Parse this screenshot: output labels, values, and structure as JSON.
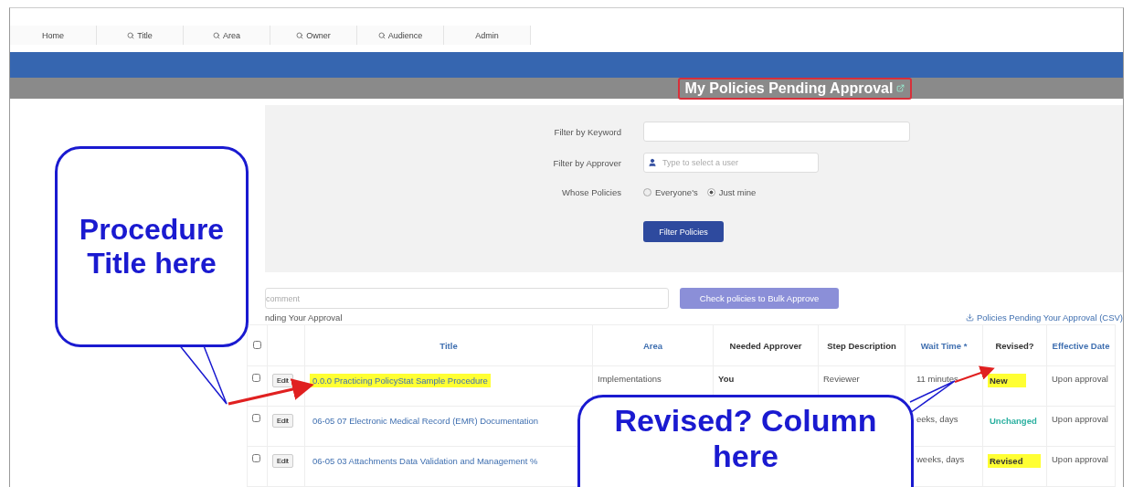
{
  "nav": {
    "tabs": [
      {
        "label": "Home",
        "search": false
      },
      {
        "label": "Title",
        "search": true
      },
      {
        "label": "Area",
        "search": true
      },
      {
        "label": "Owner",
        "search": true
      },
      {
        "label": "Audience",
        "search": true
      },
      {
        "label": "Admin",
        "search": false
      }
    ]
  },
  "header": {
    "title": "My Policies Pending Approval"
  },
  "filters": {
    "keyword": {
      "label": "Filter by Keyword"
    },
    "approver": {
      "label": "Filter by Approver",
      "placeholder": "Type to select a user"
    },
    "whose": {
      "label": "Whose Policies",
      "options": [
        {
          "label": "Everyone's",
          "selected": false
        },
        {
          "label": "Just mine",
          "selected": true
        }
      ]
    },
    "button": "Filter Policies"
  },
  "bulk": {
    "comment_placeholder": "comment",
    "button": "Check policies to Bulk Approve",
    "caption": "nding Your Approval",
    "csv_link": "Policies Pending Your Approval (CSV)"
  },
  "table": {
    "select_all_checked": false,
    "columns": [
      {
        "label": "Title",
        "sortable": true
      },
      {
        "label": "Area",
        "sortable": true
      },
      {
        "label": "Needed Approver",
        "sortable": false
      },
      {
        "label": "Step Description",
        "sortable": false
      },
      {
        "label": "Wait Time *",
        "sortable": true
      },
      {
        "label": "Revised?",
        "sortable": false
      },
      {
        "label": "Effective Date",
        "sortable": true
      }
    ],
    "rows": [
      {
        "checked": false,
        "edit": "Edit",
        "title": "0.0.0 Practicing PolicyStat Sample Procedure",
        "title_highlighted": true,
        "area": "Implementations",
        "approver": "You",
        "step": "Reviewer",
        "wait": "11 minutes",
        "revised": {
          "text": "New",
          "kind": "new",
          "highlighted": true
        },
        "effective": "Upon approval"
      },
      {
        "checked": false,
        "edit": "Edit",
        "title": "06-05 07 Electronic Medical Record (EMR) Documentation",
        "title_highlighted": false,
        "wait": "eeks, days",
        "revised": {
          "text": "Unchanged",
          "kind": "unchanged",
          "highlighted": false
        },
        "effective": "Upon approval"
      },
      {
        "checked": false,
        "edit": "Edit",
        "title": "06-05 03 Attachments Data Validation and Management %",
        "title_highlighted": false,
        "wait": "weeks, days",
        "revised": {
          "text": "Revised",
          "kind": "revised",
          "highlighted": true
        },
        "effective": "Upon approval"
      }
    ]
  },
  "annotations": [
    {
      "text": "Procedure Title here",
      "kind": "left"
    },
    {
      "text": "Revised? Column here",
      "kind": "right"
    }
  ]
}
